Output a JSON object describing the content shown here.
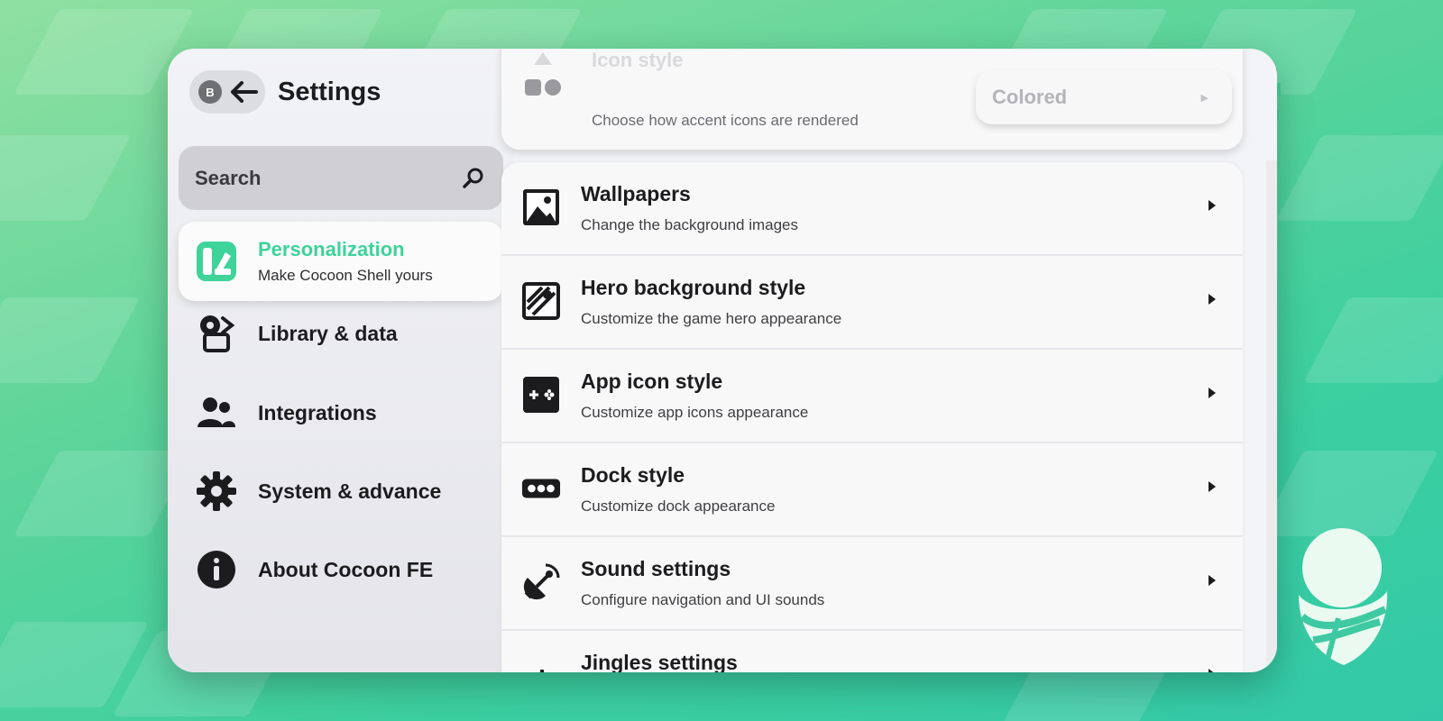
{
  "header": {
    "back_button_label": "B",
    "title": "Settings"
  },
  "search": {
    "label": "Search"
  },
  "sidebar": {
    "active": {
      "title": "Personalization",
      "subtitle": "Make Cocoon Shell yours",
      "icon": "personalization-icon"
    },
    "items": [
      {
        "label": "Library & data",
        "icon": "library-icon"
      },
      {
        "label": "Integrations",
        "icon": "people-icon"
      },
      {
        "label": "System & advance",
        "icon": "gear-icon"
      },
      {
        "label": "About Cocoon FE",
        "icon": "info-icon"
      }
    ]
  },
  "top_card": {
    "title": "Icon style",
    "subtitle": "Choose how accent icons are rendered",
    "value": "Colored"
  },
  "rows": [
    {
      "title": "Wallpapers",
      "subtitle": "Change the background images",
      "icon": "image-icon"
    },
    {
      "title": "Hero background style",
      "subtitle": "Customize the game hero appearance",
      "icon": "hero-image-icon"
    },
    {
      "title": "App icon style",
      "subtitle": "Customize app icons appearance",
      "icon": "gamepad-icon"
    },
    {
      "title": "Dock style",
      "subtitle": "Customize dock appearance",
      "icon": "dock-icon"
    },
    {
      "title": "Sound settings",
      "subtitle": "Configure navigation and UI sounds",
      "icon": "satellite-icon"
    },
    {
      "title": "Jingles settings",
      "subtitle": "",
      "icon": "music-note-icon"
    }
  ],
  "colors": {
    "accent": "#3ed399",
    "background": "#4fd39c"
  }
}
